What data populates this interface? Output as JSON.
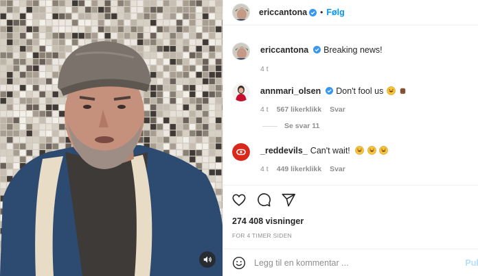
{
  "header": {
    "username": "ericcantona",
    "separator": "•",
    "follow_label": "Følg"
  },
  "caption": {
    "username": "ericcantona",
    "text": "Breaking news!",
    "time": "4 t"
  },
  "comments": [
    {
      "username": "annmari_olsen",
      "text": "Don't fool us",
      "time": "4 t",
      "likes": "567 likerklikk",
      "reply": "Svar",
      "see_replies": "Se svar 11"
    },
    {
      "username": "_reddevils_",
      "text": "Can't wait!",
      "time": "4 t",
      "likes": "449 likerklikk",
      "reply": "Svar"
    }
  ],
  "stats": {
    "views": "274 408 visninger",
    "time_ago": "FOR 4 TIMER SIDEN"
  },
  "composer": {
    "placeholder": "Legg til en kommentar ...",
    "publish_label": "Pub"
  },
  "colors": {
    "accent": "#0095f6",
    "verified": "#3897f0",
    "reddevils": "#da291c"
  },
  "icons": [
    "verified-badge-icon",
    "heart-icon",
    "comment-icon",
    "share-icon",
    "emoji-icon",
    "speaker-icon"
  ]
}
